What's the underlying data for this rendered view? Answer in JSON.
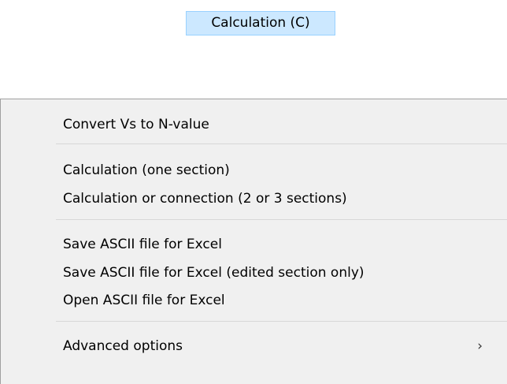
{
  "menubar": {
    "active_item": "Calculation (C)"
  },
  "menu": {
    "items": [
      {
        "label": "Convert Vs to N-value"
      },
      {
        "label": "Calculation (one section)"
      },
      {
        "label": "Calculation or connection (2 or 3 sections)"
      },
      {
        "label": "Save ASCII file for Excel"
      },
      {
        "label": "Save ASCII file for Excel (edited section only)"
      },
      {
        "label": "Open ASCII file for Excel"
      },
      {
        "label": "Advanced options",
        "submenu_icon": "chevron-right-icon"
      }
    ]
  }
}
